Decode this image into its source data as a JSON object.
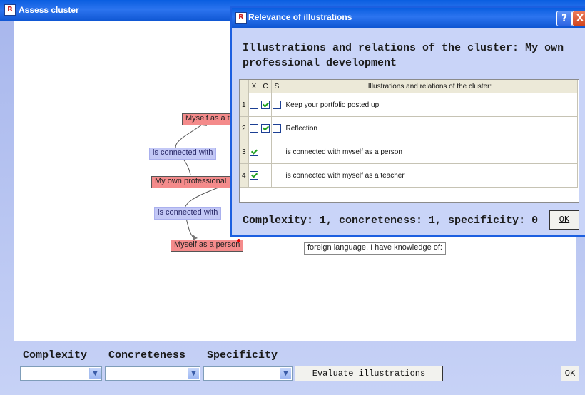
{
  "main_window": {
    "title": "Assess cluster",
    "app_icon": "R",
    "nodes": {
      "myself_teacher": "Myself as a te",
      "relation_upper": "is connected with",
      "my_professional": "My own professional",
      "relation_lower": "is connected with",
      "myself_person": "Myself as a person",
      "foreign_language": "foreign language, I have knowledge of:"
    },
    "bottom": {
      "complexity_label": "Complexity",
      "concreteness_label": "Concreteness",
      "specificity_label": "Specificity",
      "complexity_value": "",
      "concreteness_value": "",
      "specificity_value": "",
      "evaluate_label": "Evaluate illustrations",
      "ok_label": "OK"
    }
  },
  "dialog": {
    "title": "Relevance of illustrations",
    "app_icon": "R",
    "help_label": "?",
    "close_label": "X",
    "heading": "Illustrations and relations of the cluster: My own professional development",
    "table": {
      "headers": [
        "X",
        "C",
        "S",
        "Illustrations and relations of the cluster:"
      ],
      "rows": [
        {
          "num": "1",
          "x": false,
          "c": true,
          "s": false,
          "has_s": true,
          "text": "Keep your portfolio posted up"
        },
        {
          "num": "2",
          "x": false,
          "c": true,
          "s": false,
          "has_s": true,
          "text": "Reflection"
        },
        {
          "num": "3",
          "x": true,
          "c": null,
          "s": null,
          "has_s": false,
          "text": "is connected with myself as a person"
        },
        {
          "num": "4",
          "x": true,
          "c": null,
          "s": null,
          "has_s": false,
          "text": "is connected with myself as a teacher"
        }
      ]
    },
    "summary": "Complexity: 1, concreteness: 1, specificity: 0",
    "ok_label": "OK"
  },
  "colors": {
    "title_bar": "#0a5ee0",
    "concept_node": "#f48b8b",
    "relation_node": "#c3c8f6",
    "checkmark": "#21a121"
  }
}
